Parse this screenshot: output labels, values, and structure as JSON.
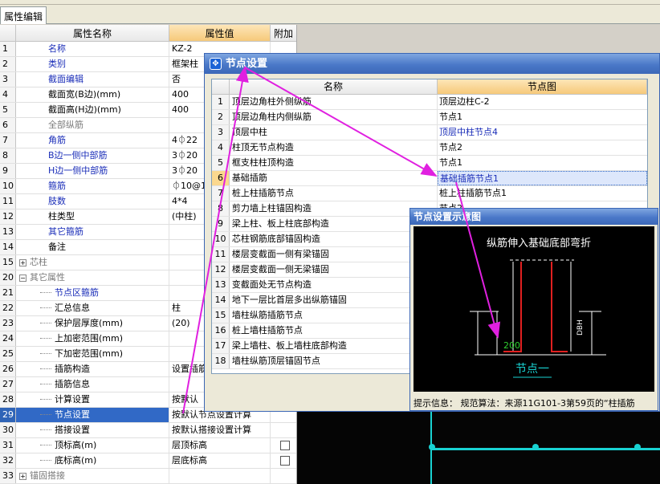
{
  "tab": {
    "label": "属性编辑"
  },
  "grid": {
    "col_name": "属性名称",
    "col_value": "属性值",
    "col_add": "附加",
    "rows": [
      {
        "num": "1",
        "name": "名称",
        "value": "KZ-2",
        "style": "blue",
        "indent": 0
      },
      {
        "num": "2",
        "name": "类别",
        "value": "框架柱",
        "style": "blue",
        "indent": 0
      },
      {
        "num": "3",
        "name": "截面编辑",
        "value": "否",
        "style": "blue",
        "indent": 0
      },
      {
        "num": "4",
        "name": "截面宽(B边)(mm)",
        "value": "400",
        "style": "black",
        "indent": 0
      },
      {
        "num": "5",
        "name": "截面高(H边)(mm)",
        "value": "400",
        "style": "black",
        "indent": 0
      },
      {
        "num": "6",
        "name": "全部纵筋",
        "value": "",
        "style": "gray",
        "indent": 0
      },
      {
        "num": "7",
        "name": "角筋",
        "value": "4⏀22",
        "style": "blue",
        "indent": 0
      },
      {
        "num": "8",
        "name": "B边一侧中部筋",
        "value": "3⏀20",
        "style": "blue",
        "indent": 0
      },
      {
        "num": "9",
        "name": "H边一侧中部筋",
        "value": "3⏀20",
        "style": "blue",
        "indent": 0
      },
      {
        "num": "10",
        "name": "箍筋",
        "value": "⏀10@10",
        "style": "blue",
        "indent": 0
      },
      {
        "num": "11",
        "name": "肢数",
        "value": "4*4",
        "style": "blue",
        "indent": 0
      },
      {
        "num": "12",
        "name": "柱类型",
        "value": "(中柱)",
        "style": "black",
        "indent": 0
      },
      {
        "num": "13",
        "name": "其它箍筋",
        "value": "",
        "style": "blue",
        "indent": 0
      },
      {
        "num": "14",
        "name": "备注",
        "value": "",
        "style": "black",
        "indent": 0
      },
      {
        "num": "15",
        "name": "芯柱",
        "value": "",
        "style": "gray",
        "indent": 0,
        "expander": "+"
      },
      {
        "num": "20",
        "name": "其它属性",
        "value": "",
        "style": "gray",
        "indent": 0,
        "expander": "−"
      },
      {
        "num": "21",
        "name": "节点区箍筋",
        "value": "",
        "style": "blue",
        "indent": 1
      },
      {
        "num": "22",
        "name": "汇总信息",
        "value": "柱",
        "style": "black",
        "indent": 1
      },
      {
        "num": "23",
        "name": "保护层厚度(mm)",
        "value": "(20)",
        "style": "black",
        "indent": 1
      },
      {
        "num": "24",
        "name": "上加密范围(mm)",
        "value": "",
        "style": "black",
        "indent": 1
      },
      {
        "num": "25",
        "name": "下加密范围(mm)",
        "value": "",
        "style": "black",
        "indent": 1
      },
      {
        "num": "26",
        "name": "插筋构造",
        "value": "设置插筋",
        "style": "black",
        "indent": 1
      },
      {
        "num": "27",
        "name": "插筋信息",
        "value": "",
        "style": "black",
        "indent": 1
      },
      {
        "num": "28",
        "name": "计算设置",
        "value": "按默认",
        "style": "black",
        "indent": 1
      },
      {
        "num": "29",
        "name": "节点设置",
        "value": "按默认节点设置计算",
        "style": "black",
        "indent": 1,
        "selected": true
      },
      {
        "num": "30",
        "name": "搭接设置",
        "value": "按默认搭接设置计算",
        "style": "black",
        "indent": 1
      },
      {
        "num": "31",
        "name": "顶标高(m)",
        "value": "层顶标高",
        "style": "black",
        "indent": 1,
        "checkbox": true
      },
      {
        "num": "32",
        "name": "底标高(m)",
        "value": "层底标高",
        "style": "black",
        "indent": 1,
        "checkbox": true
      },
      {
        "num": "33",
        "name": "锚固搭接",
        "value": "",
        "style": "gray",
        "indent": 0,
        "expander": "+"
      }
    ]
  },
  "dialog": {
    "title": "节点设置",
    "col_name": "名称",
    "col_pic": "节点图",
    "rows": [
      {
        "num": "1",
        "name": "顶层边角柱外侧纵筋",
        "pic": "顶层边柱C-2"
      },
      {
        "num": "2",
        "name": "顶层边角柱内侧纵筋",
        "pic": "节点1"
      },
      {
        "num": "3",
        "name": "顶层中柱",
        "pic": "顶层中柱节点4",
        "link": true
      },
      {
        "num": "4",
        "name": "柱顶无节点构造",
        "pic": "节点2"
      },
      {
        "num": "5",
        "name": "框支柱柱顶构造",
        "pic": "节点1"
      },
      {
        "num": "6",
        "name": "基础插筋",
        "pic": "基础插筋节点1",
        "link": true,
        "highlight": true
      },
      {
        "num": "7",
        "name": "桩上柱插筋节点",
        "pic": "桩上柱插筋节点1"
      },
      {
        "num": "8",
        "name": "剪力墙上柱锚固构造",
        "pic": "节点2"
      },
      {
        "num": "9",
        "name": "梁上柱、板上柱底部构造",
        "pic": ""
      },
      {
        "num": "10",
        "name": "芯柱钢筋底部锚固构造",
        "pic": ""
      },
      {
        "num": "11",
        "name": "楼层变截面一侧有梁锚固",
        "pic": ""
      },
      {
        "num": "12",
        "name": "楼层变截面一侧无梁锚固",
        "pic": ""
      },
      {
        "num": "13",
        "name": "变截面处无节点构造",
        "pic": ""
      },
      {
        "num": "14",
        "name": "地下一层比首层多出纵筋锚固",
        "pic": ""
      },
      {
        "num": "15",
        "name": "墙柱纵筋插筋节点",
        "pic": ""
      },
      {
        "num": "16",
        "name": "桩上墙柱插筋节点",
        "pic": ""
      },
      {
        "num": "17",
        "name": "梁上墙柱、板上墙柱底部构造",
        "pic": ""
      },
      {
        "num": "18",
        "name": "墙柱纵筋顶层锚固节点",
        "pic": ""
      }
    ]
  },
  "schematic": {
    "title": "节点设置示意图",
    "caption": "纵筋伸入基础底部弯折",
    "dim_left": "200",
    "dim_right": "DBH",
    "node_label": "节点一",
    "hint": "提示信息：  规范算法：来源11G101-3第59页的“柱插筋"
  },
  "colors": {
    "arrow": "#e020e0",
    "selection": "#3169c6",
    "header_accent": "#f6c97a",
    "drawing_line": "#19d2d2"
  }
}
